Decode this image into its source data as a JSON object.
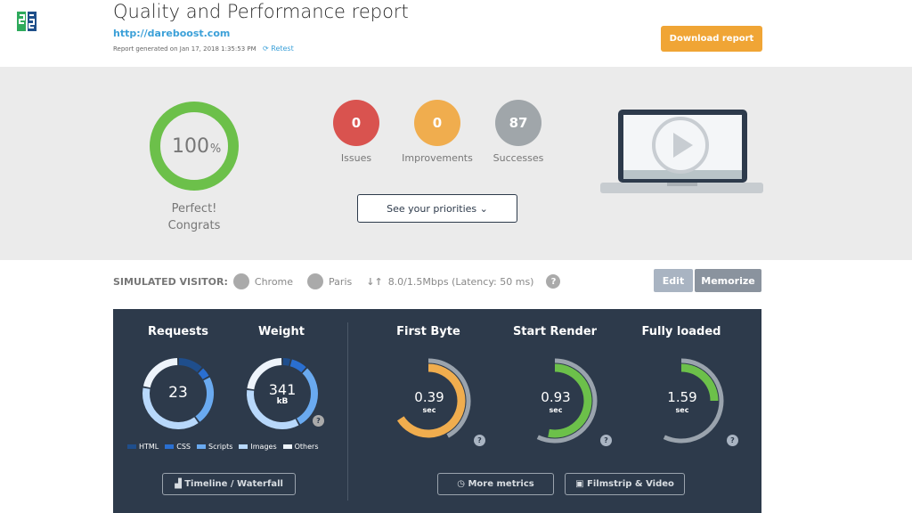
{
  "header": {
    "title": "Quality and Performance report",
    "url": "http://dareboost.com",
    "generated": "Report generated on Jan 17, 2018 1:35:53 PM",
    "retest": "Retest",
    "download": "Download report"
  },
  "summary": {
    "score": "100",
    "score_unit": "%",
    "score_fraction": 1.0,
    "verdict_line1": "Perfect!",
    "verdict_line2": "Congrats",
    "issues": {
      "count": "0",
      "label": "Issues",
      "color": "#d9534f"
    },
    "improvements": {
      "count": "0",
      "label": "Improvements",
      "color": "#f0ad4e"
    },
    "successes": {
      "count": "87",
      "label": "Successes",
      "color": "#a0a6aa"
    },
    "priorities": "See your priorities"
  },
  "visitor": {
    "label": "SIMULATED VISITOR:",
    "browser": "Chrome",
    "location": "Paris",
    "connection": "8.0/1.5Mbps (Latency: 50 ms)",
    "help": "?",
    "edit": "Edit",
    "memorize": "Memorize"
  },
  "metrics": {
    "requests": {
      "title": "Requests",
      "value": "23",
      "shares": [
        12,
        5,
        23,
        38,
        22
      ]
    },
    "weight": {
      "title": "Weight",
      "value": "341",
      "unit": "kB",
      "shares": [
        4,
        8,
        30,
        35,
        23
      ]
    },
    "legend": [
      {
        "label": "HTML",
        "color": "#1f4e8c"
      },
      {
        "label": "CSS",
        "color": "#2a6fd1"
      },
      {
        "label": "Scripts",
        "color": "#6aaaf0"
      },
      {
        "label": "Images",
        "color": "#b8d8fb"
      },
      {
        "label": "Others",
        "color": "#eef4fb"
      }
    ],
    "timings": [
      {
        "title": "First Byte",
        "value": "0.39",
        "unit": "sec",
        "color": "#f0ad4e",
        "fill_fraction": 0.66,
        "ref_fraction": 0.42
      },
      {
        "title": "Start Render",
        "value": "0.93",
        "unit": "sec",
        "color": "#6cc04a",
        "fill_fraction": 0.53,
        "ref_fraction": 0.57
      },
      {
        "title": "Fully loaded",
        "value": "1.59",
        "unit": "sec",
        "color": "#6cc04a",
        "fill_fraction": 0.25,
        "ref_fraction": 0.57
      }
    ],
    "timeline": "Timeline / Waterfall",
    "more": "More metrics",
    "filmstrip": "Filmstrip & Video",
    "help": "?"
  }
}
